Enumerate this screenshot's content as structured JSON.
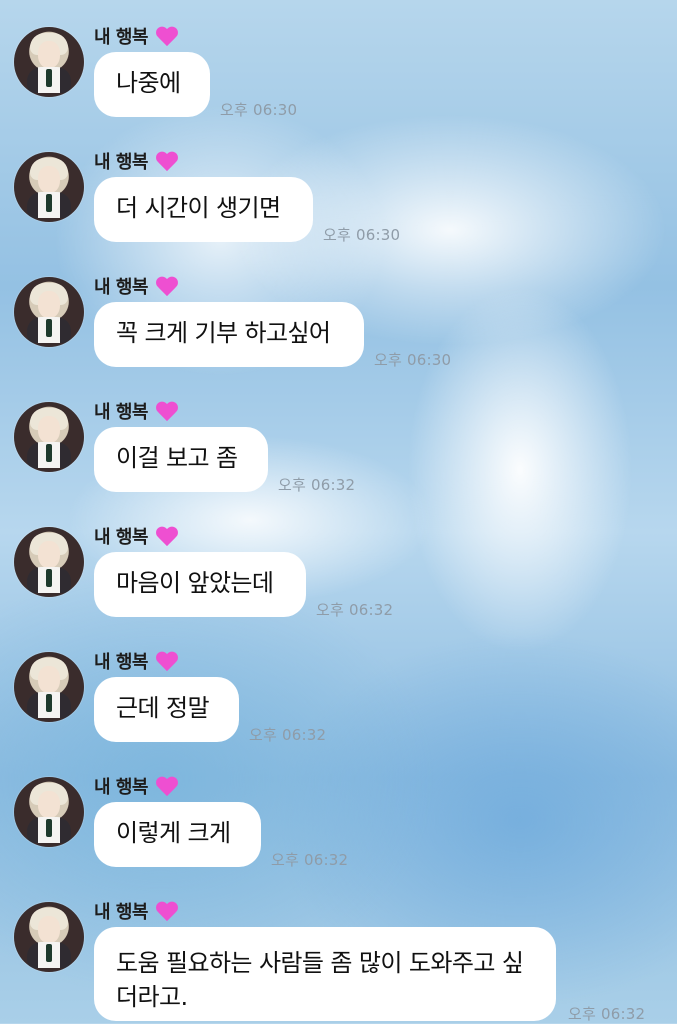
{
  "messages": [
    {
      "sender": "내 행복",
      "text": "나중에",
      "time": "오후 06:30"
    },
    {
      "sender": "내 행복",
      "text": "더 시간이 생기면",
      "time": "오후 06:30"
    },
    {
      "sender": "내 행복",
      "text": "꼭 크게 기부 하고싶어",
      "time": "오후 06:30"
    },
    {
      "sender": "내 행복",
      "text": "이걸 보고 좀",
      "time": "오후 06:32"
    },
    {
      "sender": "내 행복",
      "text": "마음이 앞았는데",
      "time": "오후 06:32"
    },
    {
      "sender": "내 행복",
      "text": "근데 정말",
      "time": "오후 06:32"
    },
    {
      "sender": "내 행복",
      "text": "이렇게 크게",
      "time": "오후 06:32"
    },
    {
      "sender": "내 행복",
      "text": "도움 필요하는 사람들 좀 많이 도와주고 싶더라고.",
      "time": "오후 06:32"
    }
  ],
  "icons": {
    "heart": "heart-icon",
    "avatar": "avatar"
  }
}
